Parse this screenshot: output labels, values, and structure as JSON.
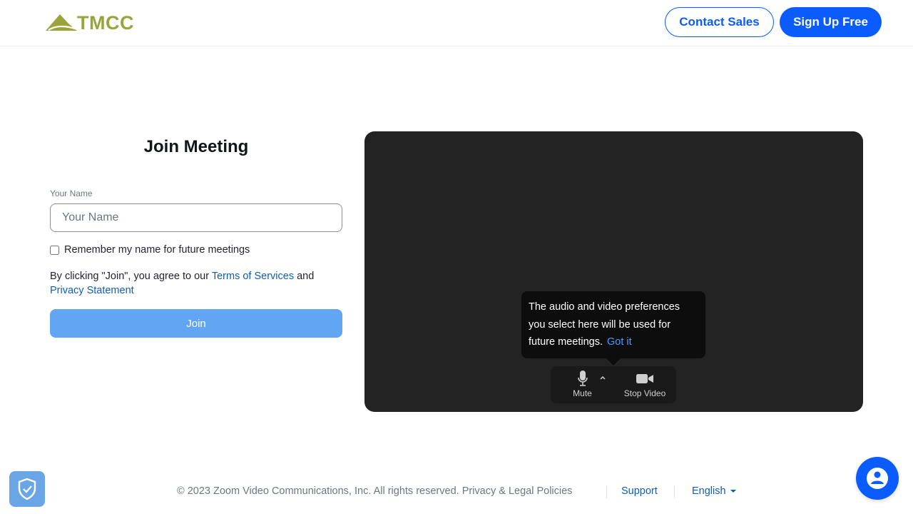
{
  "header": {
    "logo_text": "TMCC",
    "contact_sales_label": "Contact Sales",
    "sign_up_label": "Sign Up Free"
  },
  "join_form": {
    "title": "Join Meeting",
    "name_label": "Your Name",
    "name_placeholder": "Your Name",
    "name_value": "",
    "remember_label": "Remember my name for future meetings",
    "remember_checked": false,
    "agree_prefix": "By clicking \"Join\", you agree to our ",
    "terms_link": "Terms of Services",
    "agree_and": " and",
    "privacy_link": "Privacy Statement",
    "join_button": "Join"
  },
  "preview": {
    "tooltip_text": "The audio and video preferences you select here will be used for future meetings.",
    "got_it": "Got it",
    "mute_label": "Mute",
    "stop_video_label": "Stop Video",
    "icons": [
      "microphone-icon",
      "chevron-up-icon",
      "video-camera-icon"
    ]
  },
  "footer": {
    "copyright": "© 2023 Zoom Video Communications, Inc. All rights reserved. ",
    "privacy_legal": "Privacy & Legal Policies",
    "support": "Support",
    "language": "English"
  },
  "widgets": {
    "shield_icon": "shield-check-icon",
    "chatbot_icon": "chatbot-icon"
  },
  "colors": {
    "brand_blue": "#0b5cff",
    "logo_green": "#9aa43a",
    "join_button": "#62a5f2",
    "link": "#0e5eb8",
    "preview_bg": "#232323"
  }
}
